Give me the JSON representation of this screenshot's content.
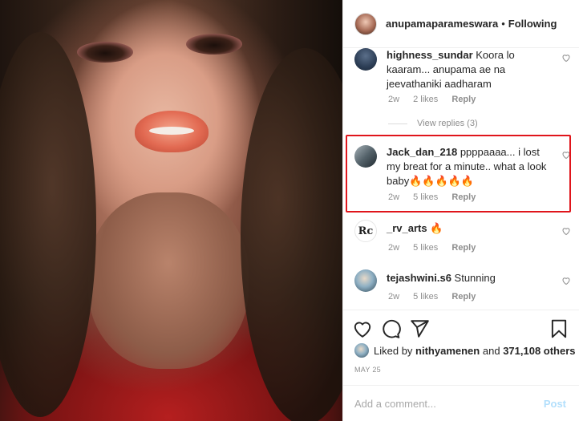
{
  "post": {
    "username": "anupamaparameswara",
    "separator": "•",
    "follow_state": "Following"
  },
  "comments": [
    {
      "user": "highness_sundar",
      "text": "Koora lo kaaram... anupama ae na jeevathaniki aadharam",
      "time": "2w",
      "likes": "2 likes",
      "reply": "Reply",
      "view_replies": "View replies (3)"
    },
    {
      "user": "Jack_dan_218",
      "text": "ppppaaaa... i lost my breat for a minute.. what a look baby🔥🔥🔥🔥🔥",
      "time": "2w",
      "likes": "5 likes",
      "reply": "Reply"
    },
    {
      "user": "_rv_arts",
      "text": "🔥",
      "time": "2w",
      "likes": "5 likes",
      "reply": "Reply",
      "avatar_glyph": "Rc"
    },
    {
      "user": "tejashwini.s6",
      "text": "Stunning",
      "time": "2w",
      "likes": "5 likes",
      "reply": "Reply"
    }
  ],
  "likes_summary": {
    "prefix": "Liked by",
    "liker": "nithyamenen",
    "middle": "and",
    "count": "371,108 others"
  },
  "date": "MAY 25",
  "add_comment": {
    "placeholder": "Add a comment...",
    "post_label": "Post"
  },
  "colors": {
    "highlight": "#e0151b",
    "post_disabled": "#b2dffc",
    "meta_text": "#8e8e8e"
  },
  "icons": [
    "heart-icon",
    "comment-icon",
    "share-icon",
    "bookmark-icon"
  ]
}
